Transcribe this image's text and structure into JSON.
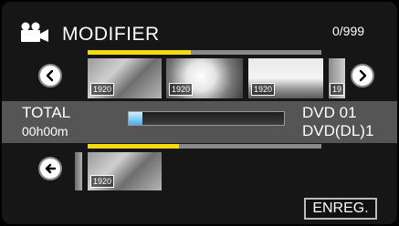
{
  "header": {
    "icon": "movie-camera-icon",
    "title": "MODIFIER",
    "counter": "0/999"
  },
  "top_strip": {
    "progress": 0.44,
    "thumbnails": [
      {
        "badge": "1920"
      },
      {
        "badge": "1920"
      },
      {
        "badge": "1920"
      },
      {
        "badge": "19"
      }
    ],
    "prev_icon": "chevron-left-icon",
    "next_icon": "chevron-right-icon"
  },
  "info": {
    "total_label": "TOTAL",
    "total_time": "00h00m",
    "capacity_used": 0.09,
    "disc_line1": "DVD  01",
    "disc_line2": "DVD(DL)1"
  },
  "bottom_strip": {
    "progress": 0.39,
    "back_icon": "arrow-left-icon",
    "thumbnails": [
      {
        "badge": "1920"
      }
    ]
  },
  "footer": {
    "save_label": "ENREG."
  },
  "colors": {
    "accent_yellow": "#f2dc0e",
    "capacity_blue": "#47b1e8",
    "band_gray": "#555555"
  }
}
